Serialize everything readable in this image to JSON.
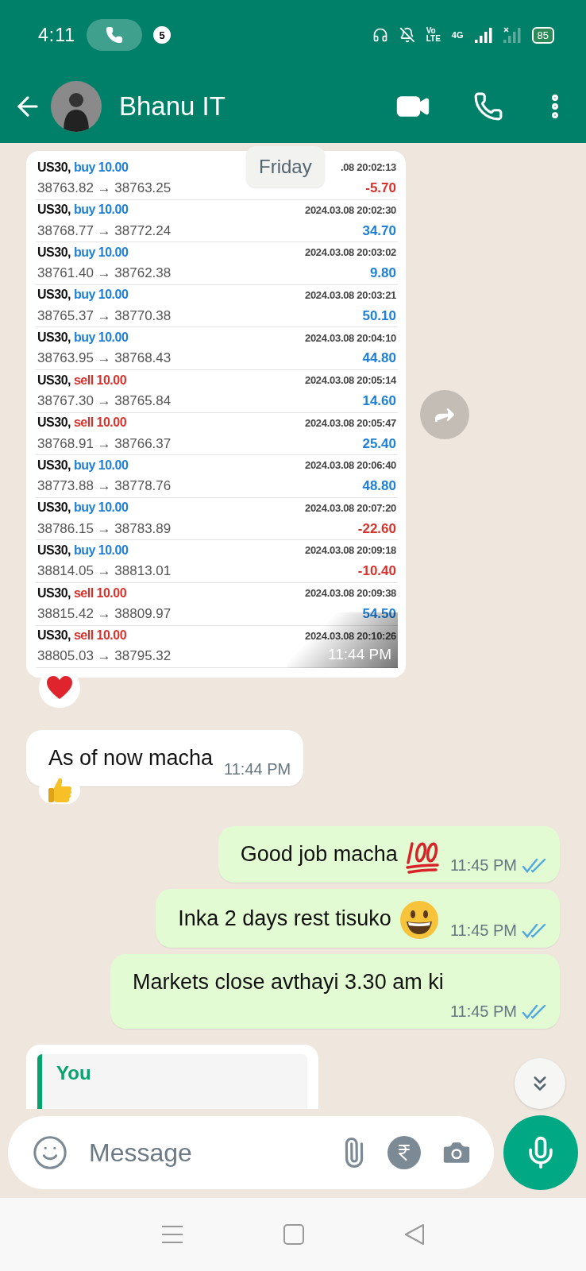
{
  "status_bar": {
    "time": "4:11",
    "notification_count": "5",
    "volte_top": "Vo",
    "volte_bottom": "LTE",
    "network": "4G",
    "battery": "85"
  },
  "header": {
    "contact_name": "Bhanu IT"
  },
  "date_chip": "Friday",
  "messages": [
    {
      "kind": "trade_image",
      "time": "11:44 PM",
      "reaction": {
        "kind": "heart"
      },
      "trades": [
        {
          "symbol": "US30,",
          "side": {
            "text": "buy 10.00",
            "color": "#1e7fd8"
          },
          "date": ".08 20:02:13",
          "prices": "38763.82 → 38763.25",
          "profit": {
            "text": "-5.70",
            "color": "#d8322c"
          }
        },
        {
          "symbol": "US30,",
          "side": {
            "text": "buy 10.00",
            "color": "#1e7fd8"
          },
          "date": "2024.03.08 20:02:30",
          "prices": "38768.77 → 38772.24",
          "profit": {
            "text": "34.70",
            "color": "#1e7fd8"
          }
        },
        {
          "symbol": "US30,",
          "side": {
            "text": "buy 10.00",
            "color": "#1e7fd8"
          },
          "date": "2024.03.08 20:03:02",
          "prices": "38761.40 → 38762.38",
          "profit": {
            "text": "9.80",
            "color": "#1e7fd8"
          }
        },
        {
          "symbol": "US30,",
          "side": {
            "text": "buy 10.00",
            "color": "#1e7fd8"
          },
          "date": "2024.03.08 20:03:21",
          "prices": "38765.37 → 38770.38",
          "profit": {
            "text": "50.10",
            "color": "#1e7fd8"
          }
        },
        {
          "symbol": "US30,",
          "side": {
            "text": "buy 10.00",
            "color": "#1e7fd8"
          },
          "date": "2024.03.08 20:04:10",
          "prices": "38763.95 → 38768.43",
          "profit": {
            "text": "44.80",
            "color": "#1e7fd8"
          }
        },
        {
          "symbol": "US30,",
          "side": {
            "text": "sell 10.00",
            "color": "#d8322c"
          },
          "date": "2024.03.08 20:05:14",
          "prices": "38767.30 → 38765.84",
          "profit": {
            "text": "14.60",
            "color": "#1e7fd8"
          }
        },
        {
          "symbol": "US30,",
          "side": {
            "text": "sell 10.00",
            "color": "#d8322c"
          },
          "date": "2024.03.08 20:05:47",
          "prices": "38768.91 → 38766.37",
          "profit": {
            "text": "25.40",
            "color": "#1e7fd8"
          }
        },
        {
          "symbol": "US30,",
          "side": {
            "text": "buy 10.00",
            "color": "#1e7fd8"
          },
          "date": "2024.03.08 20:06:40",
          "prices": "38773.88 → 38778.76",
          "profit": {
            "text": "48.80",
            "color": "#1e7fd8"
          }
        },
        {
          "symbol": "US30,",
          "side": {
            "text": "buy 10.00",
            "color": "#1e7fd8"
          },
          "date": "2024.03.08 20:07:20",
          "prices": "38786.15 → 38783.89",
          "profit": {
            "text": "-22.60",
            "color": "#d8322c"
          }
        },
        {
          "symbol": "US30,",
          "side": {
            "text": "buy 10.00",
            "color": "#1e7fd8"
          },
          "date": "2024.03.08 20:09:18",
          "prices": "38814.05 → 38813.01",
          "profit": {
            "text": "-10.40",
            "color": "#d8322c"
          }
        },
        {
          "symbol": "US30,",
          "side": {
            "text": "sell 10.00",
            "color": "#d8322c"
          },
          "date": "2024.03.08 20:09:38",
          "prices": "38815.42 → 38809.97",
          "profit": {
            "text": "54.50",
            "color": "#1e7fd8"
          }
        },
        {
          "symbol": "US30,",
          "side": {
            "text": "sell 10.00",
            "color": "#d8322c"
          },
          "date": "2024.03.08 20:10:26",
          "prices": "38805.03 → 38795.32"
        }
      ]
    },
    {
      "kind": "incoming",
      "text": "As of now macha",
      "time": "11:44 PM",
      "reaction": {
        "kind": "thumbs_up"
      }
    },
    {
      "kind": "outgoing",
      "text": "Good job macha",
      "emoji": {
        "kind": "hundred"
      },
      "time": "11:45 PM",
      "read": true
    },
    {
      "kind": "outgoing",
      "text": "Inka 2 days rest tisuko",
      "emoji": {
        "kind": "grin"
      },
      "time": "11:45 PM",
      "read": true
    },
    {
      "kind": "outgoing",
      "text": "Markets close avthayi 3.30 am ki",
      "time": "11:45 PM",
      "read": true
    },
    {
      "kind": "quote",
      "quote_author": "You"
    }
  ],
  "composer": {
    "placeholder": "Message"
  }
}
